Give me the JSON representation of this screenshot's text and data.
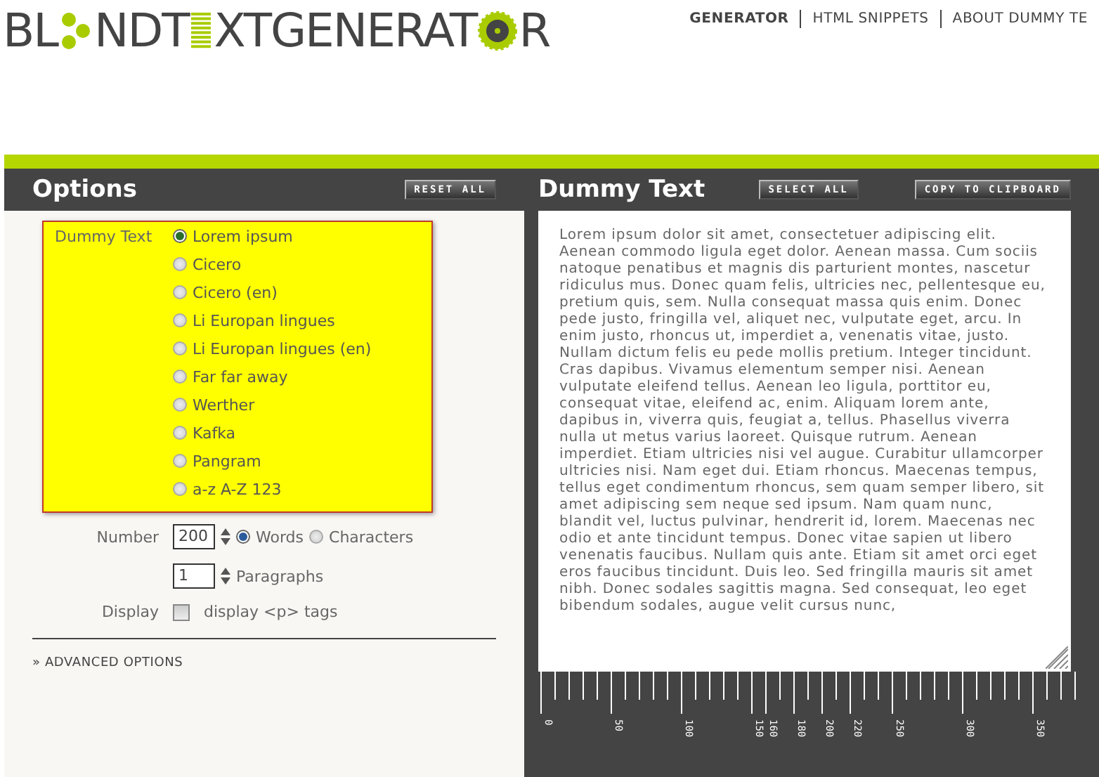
{
  "logo": {
    "parts": [
      "BL",
      "NDT",
      "XTGENERAT",
      "R"
    ]
  },
  "nav": [
    {
      "label": "GENERATOR",
      "selected": true
    },
    {
      "label": "HTML SNIPPETS",
      "selected": false
    },
    {
      "label": "ABOUT DUMMY TE",
      "selected": false
    }
  ],
  "options": {
    "title": "Options",
    "reset_button": "RESET ALL",
    "dummy_text": {
      "label": "Dummy Text",
      "choices": [
        {
          "label": "Lorem ipsum",
          "selected": true
        },
        {
          "label": "Cicero",
          "selected": false
        },
        {
          "label": "Cicero (en)",
          "selected": false
        },
        {
          "label": "Li Europan lingues",
          "selected": false
        },
        {
          "label": "Li Europan lingues (en)",
          "selected": false
        },
        {
          "label": "Far far away",
          "selected": false
        },
        {
          "label": "Werther",
          "selected": false
        },
        {
          "label": "Kafka",
          "selected": false
        },
        {
          "label": "Pangram",
          "selected": false
        },
        {
          "label": "a-z A-Z 123",
          "selected": false
        }
      ]
    },
    "number": {
      "label": "Number",
      "value": "200",
      "units": [
        {
          "label": "Words",
          "selected": true
        },
        {
          "label": "Characters",
          "selected": false
        }
      ]
    },
    "paragraphs": {
      "value": "1",
      "label": "Paragraphs"
    },
    "display": {
      "label": "Display",
      "checked": false,
      "option_label": "display <p> tags"
    },
    "advanced_link": "» ADVANCED OPTIONS"
  },
  "output": {
    "title": "Dummy Text",
    "select_all_button": "SELECT ALL",
    "copy_button": "COPY TO CLIPBOARD",
    "text": "Lorem ipsum dolor sit amet, consectetuer adipiscing elit. Aenean commodo ligula eget dolor. Aenean massa. Cum sociis natoque penatibus et magnis dis parturient montes, nascetur ridiculus mus. Donec quam felis, ultricies nec, pellentesque eu, pretium quis, sem. Nulla consequat massa quis enim. Donec pede justo, fringilla vel, aliquet nec, vulputate eget, arcu. In enim justo, rhoncus ut, imperdiet a, venenatis vitae, justo. Nullam dictum felis eu pede mollis pretium. Integer tincidunt. Cras dapibus. Vivamus elementum semper nisi. Aenean vulputate eleifend tellus. Aenean leo ligula, porttitor eu, consequat vitae, eleifend ac, enim. Aliquam lorem ante, dapibus in, viverra quis, feugiat a, tellus. Phasellus viverra nulla ut metus varius laoreet. Quisque rutrum. Aenean imperdiet. Etiam ultricies nisi vel augue. Curabitur ullamcorper ultricies nisi. Nam eget dui. Etiam rhoncus. Maecenas tempus, tellus eget condimentum rhoncus, sem quam semper libero, sit amet adipiscing sem neque sed ipsum. Nam quam nunc, blandit vel, luctus pulvinar, hendrerit id, lorem. Maecenas nec odio et ante tincidunt tempus. Donec vitae sapien ut libero venenatis faucibus. Nullam quis ante. Etiam sit amet orci eget eros faucibus tincidunt. Duis leo. Sed fringilla mauris sit amet nibh. Donec sodales sagittis magna. Sed consequat, leo eget bibendum sodales, augue velit cursus nunc,",
    "ruler_labels": [
      "0",
      "50",
      "100",
      "150",
      "160",
      "180",
      "200",
      "220",
      "250",
      "300",
      "350"
    ]
  }
}
